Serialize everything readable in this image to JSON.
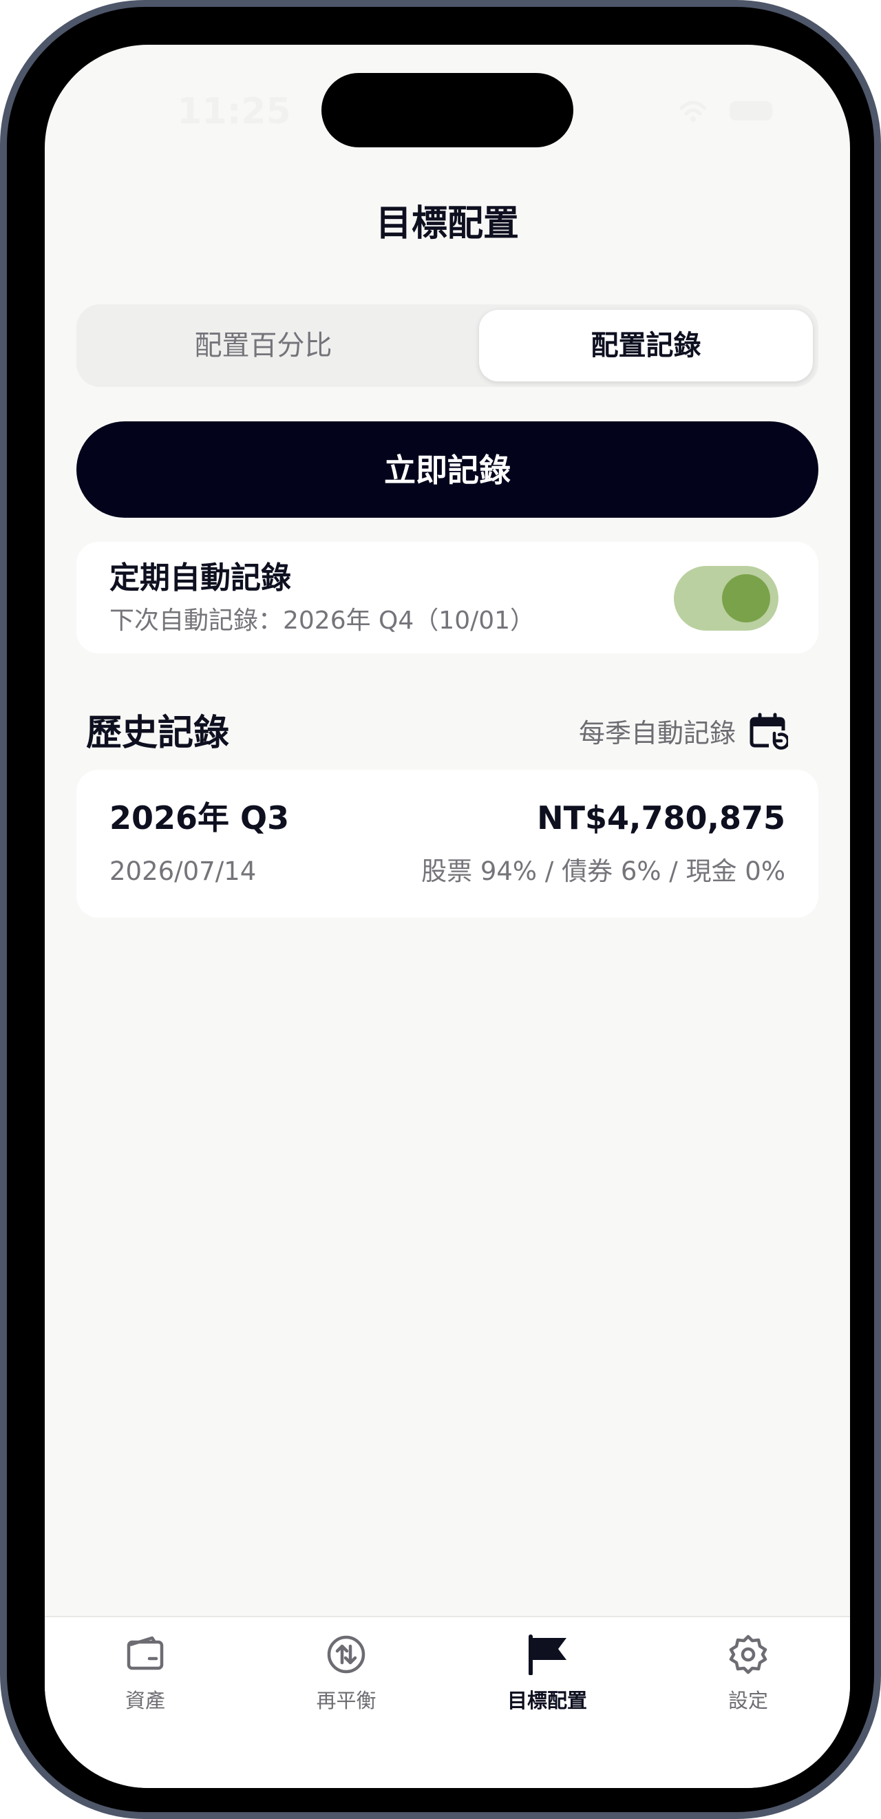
{
  "status_bar": {
    "time": "11:25"
  },
  "header": {
    "title": "目標配置"
  },
  "segmented": {
    "tabs": [
      {
        "label": "配置百分比",
        "selected": false
      },
      {
        "label": "配置記錄",
        "selected": true
      }
    ]
  },
  "actions": {
    "record_now_label": "立即記錄"
  },
  "auto_record": {
    "title": "定期自動記錄",
    "subtitle": "下次自動記錄：2026年 Q4（10/01）",
    "enabled": true
  },
  "history": {
    "title": "歷史記錄",
    "frequency_label": "每季自動記錄",
    "frequency_icon": "calendar-repeat-icon",
    "records": [
      {
        "quarter": "2026年 Q3",
        "amount": "NT$4,780,875",
        "date": "2026/07/14",
        "allocation": "股票 94% / 債券 6% / 現金 0%"
      }
    ]
  },
  "tab_bar": {
    "items": [
      {
        "label": "資產",
        "icon": "wallet-icon",
        "active": false
      },
      {
        "label": "再平衡",
        "icon": "rebalance-arrows-icon",
        "active": false
      },
      {
        "label": "目標配置",
        "icon": "flag-icon",
        "active": true
      },
      {
        "label": "設定",
        "icon": "gear-icon",
        "active": false
      }
    ]
  },
  "colors": {
    "primary_dark": "#03031c",
    "toggle_track": "#bad0a1",
    "toggle_knob": "#7aa24a",
    "background": "#f8f8f6",
    "text_secondary": "#74747a"
  }
}
